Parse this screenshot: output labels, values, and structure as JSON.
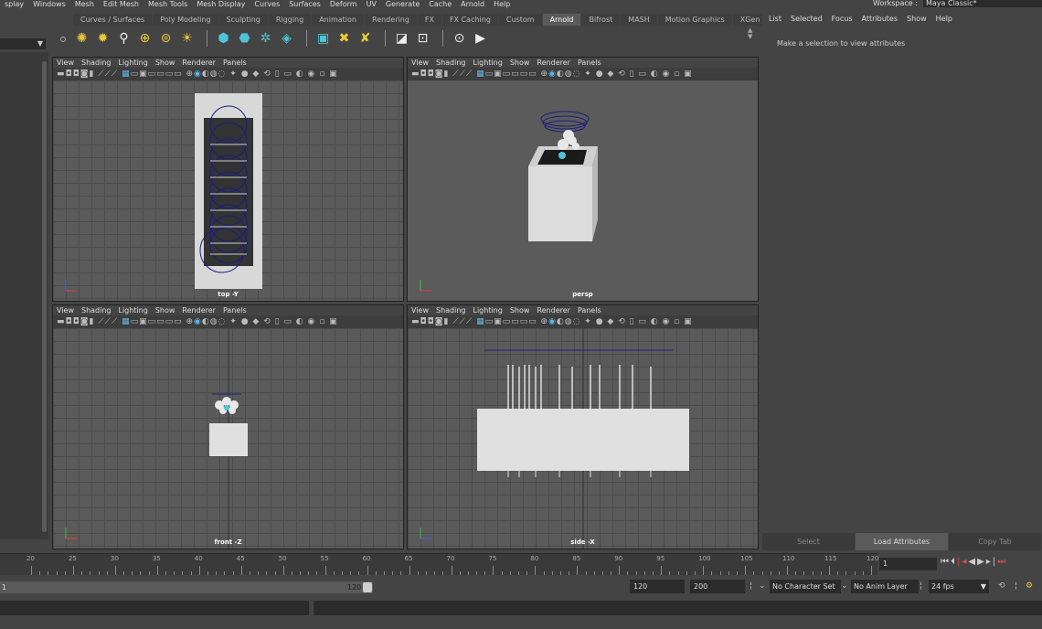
{
  "menubar": {
    "items": [
      "splay",
      "Windows",
      "Mesh",
      "Edit Mesh",
      "Mesh Tools",
      "Mesh Display",
      "Curves",
      "Surfaces",
      "Deform",
      "UV",
      "Generate",
      "Cache",
      "Arnold",
      "Help"
    ],
    "workspace_label": "Workspace :",
    "workspace_value": "Maya Classic*"
  },
  "shelf": {
    "tabs": [
      "Curves / Surfaces",
      "Poly Modeling",
      "Sculpting",
      "Rigging",
      "Animation",
      "Rendering",
      "FX",
      "FX Caching",
      "Custom",
      "Arnold",
      "Bifrost",
      "MASH",
      "Motion Graphics",
      "XGen"
    ],
    "active_tab": "Arnold",
    "icons": [
      "area-light-icon",
      "skydome-light-icon",
      "mesh-light-icon",
      "photometric-light-icon",
      "physical-sky-icon",
      "light-portal-icon",
      "standin-icon",
      "volume-icon",
      "curves-icon",
      "material-icon",
      "render-view-icon",
      "texture-manager-icon",
      "license-icon",
      "flush-cache-icon",
      "ipr-icon",
      "render-icon"
    ]
  },
  "viewport_menu": [
    "View",
    "Shading",
    "Lighting",
    "Show",
    "Renderer",
    "Panels"
  ],
  "viewports": {
    "top": "top -Y",
    "persp": "persp",
    "front": "front -Z",
    "side": "side -X"
  },
  "attribute_editor": {
    "menu": [
      "List",
      "Selected",
      "Focus",
      "Attributes",
      "Show",
      "Help"
    ],
    "message": "Make a selection to view attributes",
    "buttons": [
      "Select",
      "Load Attributes",
      "Copy Tab"
    ]
  },
  "timeline": {
    "ticks": [
      20,
      25,
      30,
      35,
      40,
      45,
      50,
      55,
      60,
      65,
      70,
      75,
      80,
      85,
      90,
      95,
      100,
      105,
      110,
      115,
      120
    ],
    "current_frame": "1"
  },
  "range": {
    "start": "1",
    "end_label": "120",
    "end": "120",
    "max": "200",
    "character_set": "No Character Set",
    "anim_layer": "No Anim Layer",
    "fps": "24 fps"
  }
}
